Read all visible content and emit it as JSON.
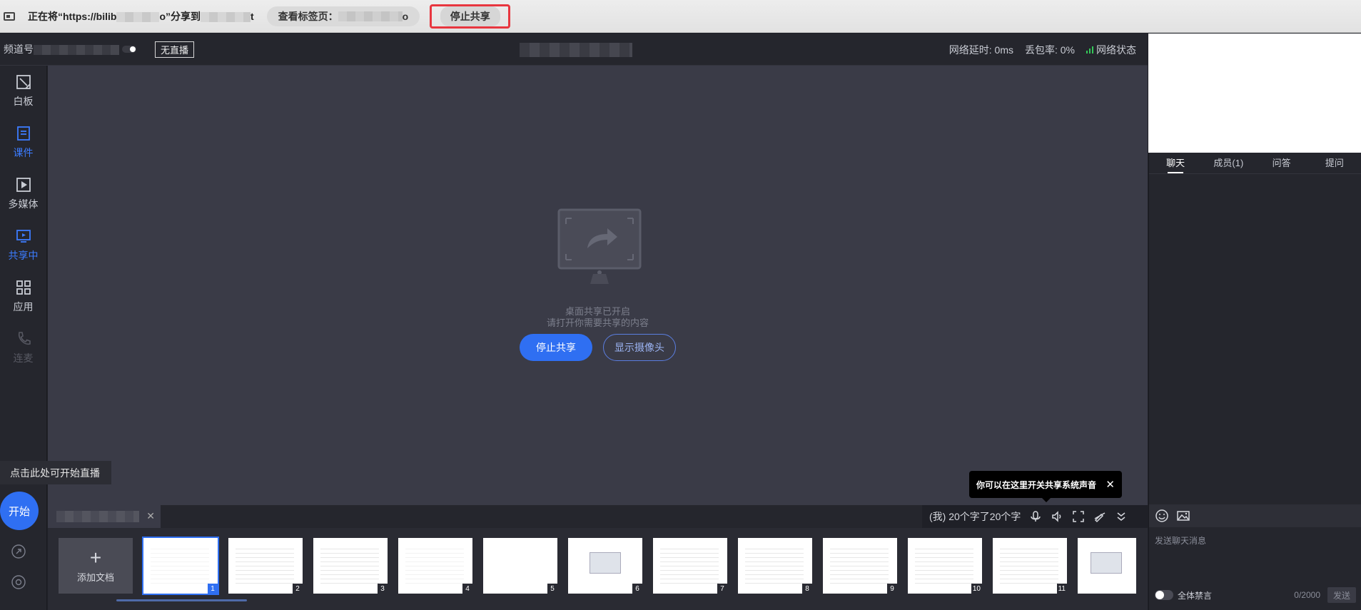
{
  "share_bar": {
    "message_prefix": "正在将“https://bilib",
    "message_suffix": "o”分享到",
    "message_tail": "t",
    "view_tab_label": "查看标签页：",
    "view_tab_tail": "o",
    "stop_share_label": "停止共享",
    "highlight_color": "#e8363f"
  },
  "header": {
    "channel_label": "频道号",
    "live_status": "无直播",
    "latency": "网络延时: 0ms",
    "packet_loss": "丢包率: 0%",
    "network_status": "网络状态"
  },
  "sidebar": {
    "items": [
      {
        "label": "白板",
        "icon": "whiteboard-icon"
      },
      {
        "label": "课件",
        "icon": "courseware-icon"
      },
      {
        "label": "多媒体",
        "icon": "multimedia-icon"
      },
      {
        "label": "共享中",
        "icon": "screen-share-icon"
      },
      {
        "label": "应用",
        "icon": "apps-grid-icon"
      },
      {
        "label": "连麦",
        "icon": "phone-icon"
      }
    ],
    "start_tip": "点击此处可开始直播",
    "start_button": "开始"
  },
  "stage": {
    "line1": "桌面共享已开启",
    "line2": "请打开你需要共享的内容",
    "stop_share_button": "停止共享",
    "show_camera_button": "显示摄像头",
    "accent_color": "#2f6ff2"
  },
  "audio_tip": {
    "text": "你可以在这里开关共享系统声音"
  },
  "doc_bar": {
    "status_text": "(我) 20个字了20个字"
  },
  "thumbnails": {
    "add_doc_label": "添加文档",
    "pages": [
      "1",
      "2",
      "3",
      "4",
      "5",
      "6",
      "7",
      "8",
      "9",
      "10",
      "11"
    ],
    "selected_page": "1"
  },
  "chat": {
    "tabs": [
      "聊天",
      "成员(1)",
      "问答",
      "提问"
    ],
    "active_tab": "聊天",
    "input_placeholder": "发送聊天消息",
    "mute_all_label": "全体禁言",
    "char_count": "0/2000",
    "send_button": "发送"
  }
}
